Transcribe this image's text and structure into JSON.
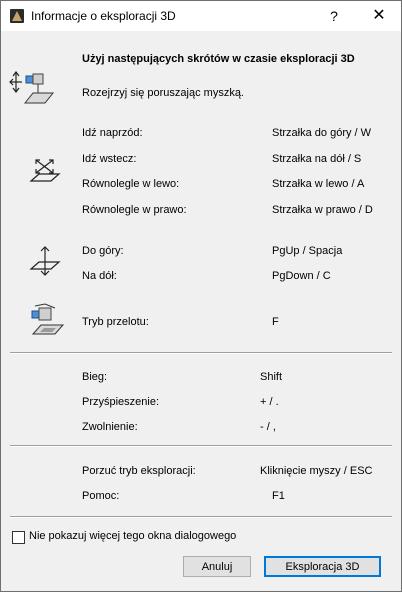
{
  "window": {
    "title": "Informacje o eksploracji 3D",
    "help_glyph": "?",
    "close_glyph": "✕"
  },
  "intro": {
    "heading": "Użyj następujących skrótów w czasie eksploracji 3D",
    "mouse_text": "Rozejrzyj się poruszając myszką."
  },
  "movement": [
    {
      "action": "Idź naprzód:",
      "key": "Strzałka do góry / W"
    },
    {
      "action": "Idź wstecz:",
      "key": "Strzałka na dół / S"
    },
    {
      "action": "Równolegle w lewo:",
      "key": "Strzałka w lewo / A"
    },
    {
      "action": "Równolegle w prawo:",
      "key": "Strzałka w prawo / D"
    }
  ],
  "vertical": [
    {
      "action": "Do góry:",
      "key": "PgUp / Spacja"
    },
    {
      "action": "Na dół:",
      "key": "PgDown / C"
    }
  ],
  "flight": {
    "action": "Tryb przelotu:",
    "key": "F"
  },
  "speed": [
    {
      "action": "Bieg:",
      "key": "Shift"
    },
    {
      "action": "Przyśpieszenie:",
      "key": "+ / ."
    },
    {
      "action": "Zwolnienie:",
      "key": "- / ,"
    }
  ],
  "other": [
    {
      "action": "Porzuć tryb eksploracji:",
      "key": "Kliknięcie myszy / ESC"
    },
    {
      "action": "Pomoc:",
      "key": "F1"
    }
  ],
  "footer": {
    "checkbox_label": "Nie pokazuj więcej tego okna dialogowego",
    "cancel_label": "Anuluj",
    "explore_label": "Eksploracja 3D"
  }
}
